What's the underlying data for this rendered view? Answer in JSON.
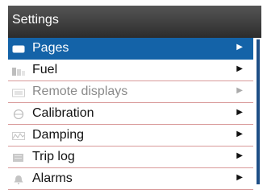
{
  "header": {
    "title": "Settings"
  },
  "menu": {
    "items": [
      {
        "label": "Pages",
        "icon": "pages-icon",
        "state": "selected"
      },
      {
        "label": "Fuel",
        "icon": "fuel-icon",
        "state": "normal"
      },
      {
        "label": "Remote displays",
        "icon": "remote-displays-icon",
        "state": "disabled"
      },
      {
        "label": "Calibration",
        "icon": "calibration-icon",
        "state": "normal"
      },
      {
        "label": "Damping",
        "icon": "damping-icon",
        "state": "normal"
      },
      {
        "label": "Trip log",
        "icon": "trip-log-icon",
        "state": "normal"
      },
      {
        "label": "Alarms",
        "icon": "alarms-icon",
        "state": "normal"
      }
    ]
  },
  "colors": {
    "header_bg": "#3a3a3a",
    "selected_bg": "#1463a8",
    "row_divider": "#d99a9a",
    "scroll_thumb": "#1e4f86"
  }
}
